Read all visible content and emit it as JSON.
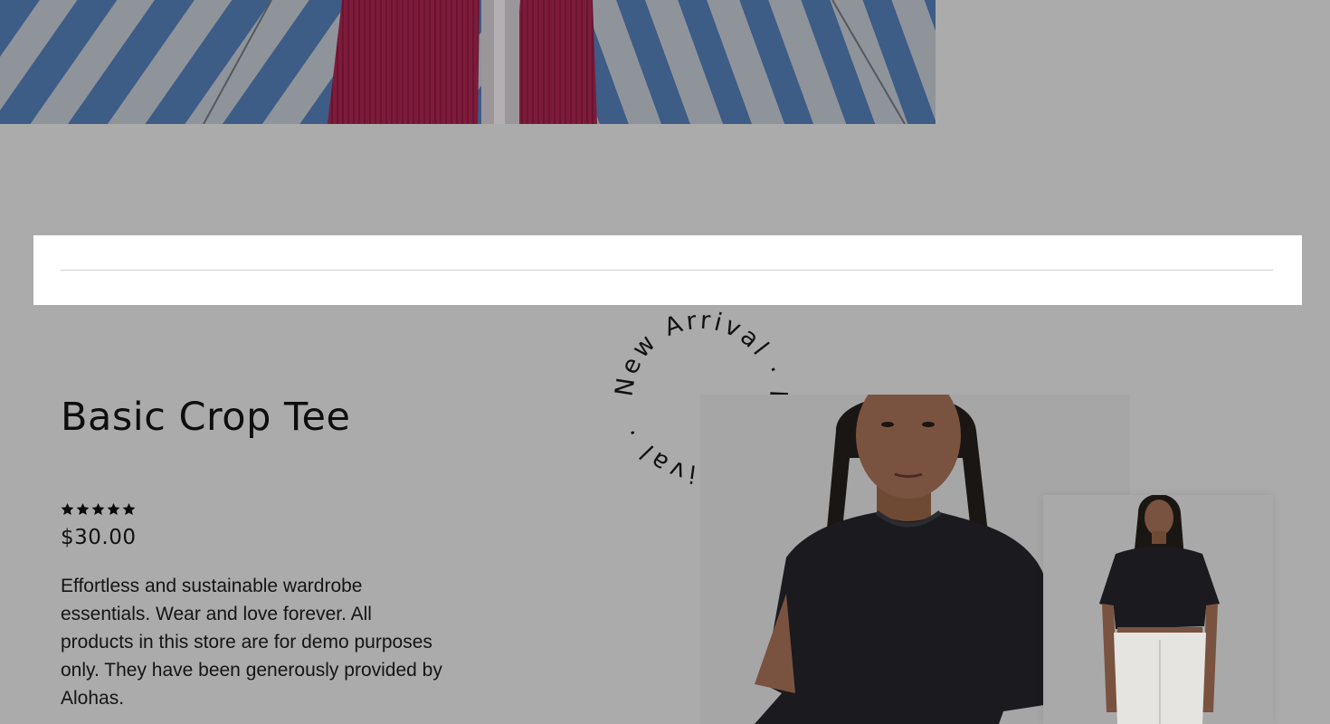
{
  "band": {},
  "product": {
    "title": "Basic Crop Tee",
    "rating": 5,
    "rating_max": 5,
    "price": "$30.00",
    "description": "Effortless and sustainable wardrobe essentials. Wear and love forever. All products in this store are for demo purposes only. They have been generously provided by Alohas."
  },
  "badge": {
    "text": "New Arrival · New Arrival ·"
  },
  "colors": {
    "overlay_background": "#ababab",
    "band": "#ffffff",
    "text": "#111111"
  }
}
